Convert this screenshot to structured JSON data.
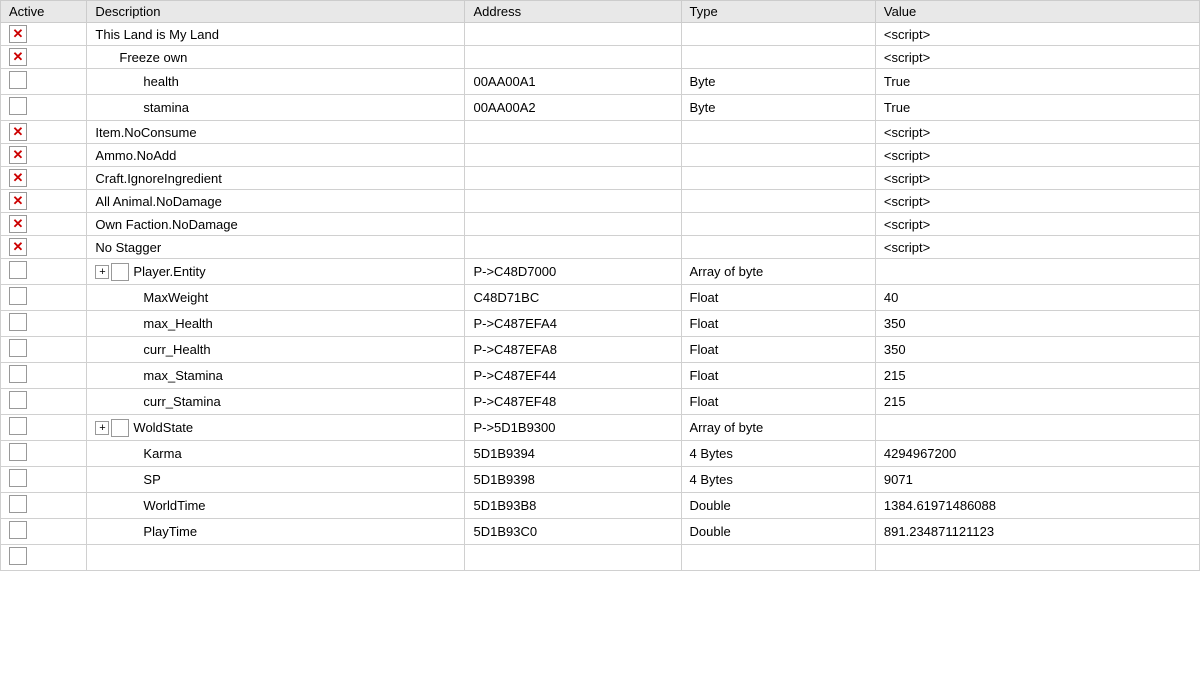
{
  "header": {
    "active": "Active",
    "description": "Description",
    "address": "Address",
    "type": "Type",
    "value": "Value"
  },
  "rows": [
    {
      "id": "root",
      "active": "x",
      "indent": 0,
      "description": "This Land is My Land",
      "address": "",
      "type": "",
      "value": "<script>"
    },
    {
      "id": "freeze-own",
      "active": "x",
      "indent": 1,
      "description": "Freeze own",
      "address": "",
      "type": "",
      "value": "<script>"
    },
    {
      "id": "health",
      "active": "empty",
      "indent": 2,
      "description": "health",
      "address": "00AA00A1",
      "type": "Byte",
      "value": "True"
    },
    {
      "id": "stamina",
      "active": "empty",
      "indent": 2,
      "description": "stamina",
      "address": "00AA00A2",
      "type": "Byte",
      "value": "True"
    },
    {
      "id": "item-noconsume",
      "active": "x",
      "indent": 0,
      "description": "Item.NoConsume",
      "address": "",
      "type": "",
      "value": "<script>"
    },
    {
      "id": "ammo-noadd",
      "active": "x",
      "indent": 0,
      "description": "Ammo.NoAdd",
      "address": "",
      "type": "",
      "value": "<script>"
    },
    {
      "id": "craft-ignoreingredient",
      "active": "x",
      "indent": 0,
      "description": "Craft.IgnoreIngredient",
      "address": "",
      "type": "",
      "value": "<script>"
    },
    {
      "id": "all-animal-nodamage",
      "active": "x",
      "indent": 0,
      "description": "All Animal.NoDamage",
      "address": "",
      "type": "",
      "value": "<script>"
    },
    {
      "id": "own-faction-nodamage",
      "active": "x",
      "indent": 0,
      "description": "Own Faction.NoDamage",
      "address": "",
      "type": "",
      "value": "<script>"
    },
    {
      "id": "no-stagger",
      "active": "x",
      "indent": 0,
      "description": "No Stagger",
      "address": "",
      "type": "",
      "value": "<script>"
    },
    {
      "id": "player-entity",
      "active": "empty",
      "indent": 0,
      "expandable": true,
      "description": "Player.Entity",
      "address": "P->C48D7000",
      "type": "Array of byte",
      "value": ""
    },
    {
      "id": "maxweight",
      "active": "empty",
      "indent": 2,
      "description": "MaxWeight",
      "address": "C48D71BC",
      "type": "Float",
      "value": "40"
    },
    {
      "id": "max-health",
      "active": "empty",
      "indent": 2,
      "description": "max_Health",
      "address": "P->C487EFA4",
      "type": "Float",
      "value": "350"
    },
    {
      "id": "curr-health",
      "active": "empty",
      "indent": 2,
      "description": "curr_Health",
      "address": "P->C487EFA8",
      "type": "Float",
      "value": "350"
    },
    {
      "id": "max-stamina",
      "active": "empty",
      "indent": 2,
      "description": "max_Stamina",
      "address": "P->C487EF44",
      "type": "Float",
      "value": "215"
    },
    {
      "id": "curr-stamina",
      "active": "empty",
      "indent": 2,
      "description": "curr_Stamina",
      "address": "P->C487EF48",
      "type": "Float",
      "value": "215"
    },
    {
      "id": "woldstate",
      "active": "empty",
      "indent": 0,
      "expandable": true,
      "description": "WoldState",
      "address": "P->5D1B9300",
      "type": "Array of byte",
      "value": ""
    },
    {
      "id": "karma",
      "active": "empty",
      "indent": 2,
      "description": "Karma",
      "address": "5D1B9394",
      "type": "4 Bytes",
      "value": "4294967200"
    },
    {
      "id": "sp",
      "active": "empty",
      "indent": 2,
      "description": "SP",
      "address": "5D1B9398",
      "type": "4 Bytes",
      "value": "9071"
    },
    {
      "id": "worldtime",
      "active": "empty",
      "indent": 2,
      "description": "WorldTime",
      "address": "5D1B93B8",
      "type": "Double",
      "value": "1384.61971486088"
    },
    {
      "id": "playtime",
      "active": "empty",
      "indent": 2,
      "description": "PlayTime",
      "address": "5D1B93C0",
      "type": "Double",
      "value": "891.234871121123"
    },
    {
      "id": "empty-row",
      "active": "empty",
      "indent": 0,
      "description": "",
      "address": "",
      "type": "",
      "value": ""
    }
  ]
}
